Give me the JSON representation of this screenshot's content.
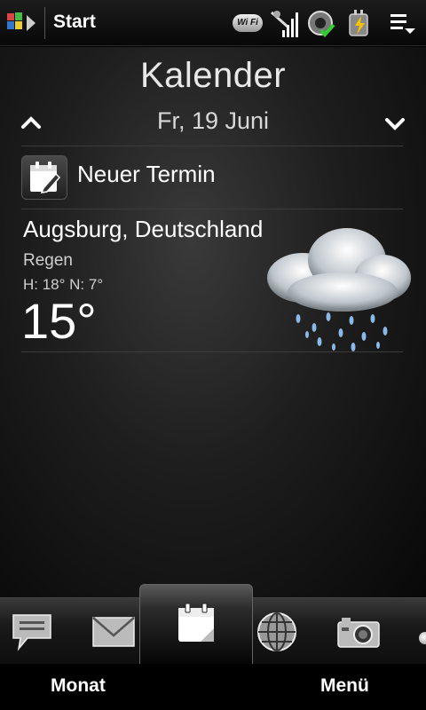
{
  "status_bar": {
    "title": "Start",
    "wifi_label": "Wi Fi",
    "icons": [
      "windows-start-icon",
      "wifi-icon",
      "signal-icon",
      "sync-icon",
      "battery-charging-icon",
      "menu-list-icon"
    ]
  },
  "calendar": {
    "title": "Kalender",
    "date": "Fr, 19 Juni",
    "new_event_label": "Neuer Termin"
  },
  "weather": {
    "city": "Augsburg, Deutschland",
    "condition": "Regen",
    "high_low": "H: 18° N: 7°",
    "temperature": "15°",
    "icon": "rain-cloud-icon"
  },
  "tabs": [
    {
      "name": "messages",
      "icon": "speech-bubble-icon"
    },
    {
      "name": "mail",
      "icon": "envelope-icon"
    },
    {
      "name": "calendar",
      "icon": "calendar-icon",
      "active": true
    },
    {
      "name": "internet",
      "icon": "globe-icon"
    },
    {
      "name": "camera",
      "icon": "camera-icon"
    }
  ],
  "softkeys": {
    "left": "Monat",
    "right": "Menü"
  },
  "colors": {
    "background": "#000000",
    "text": "#ffffff",
    "secondary_text": "#cfcfcf"
  }
}
